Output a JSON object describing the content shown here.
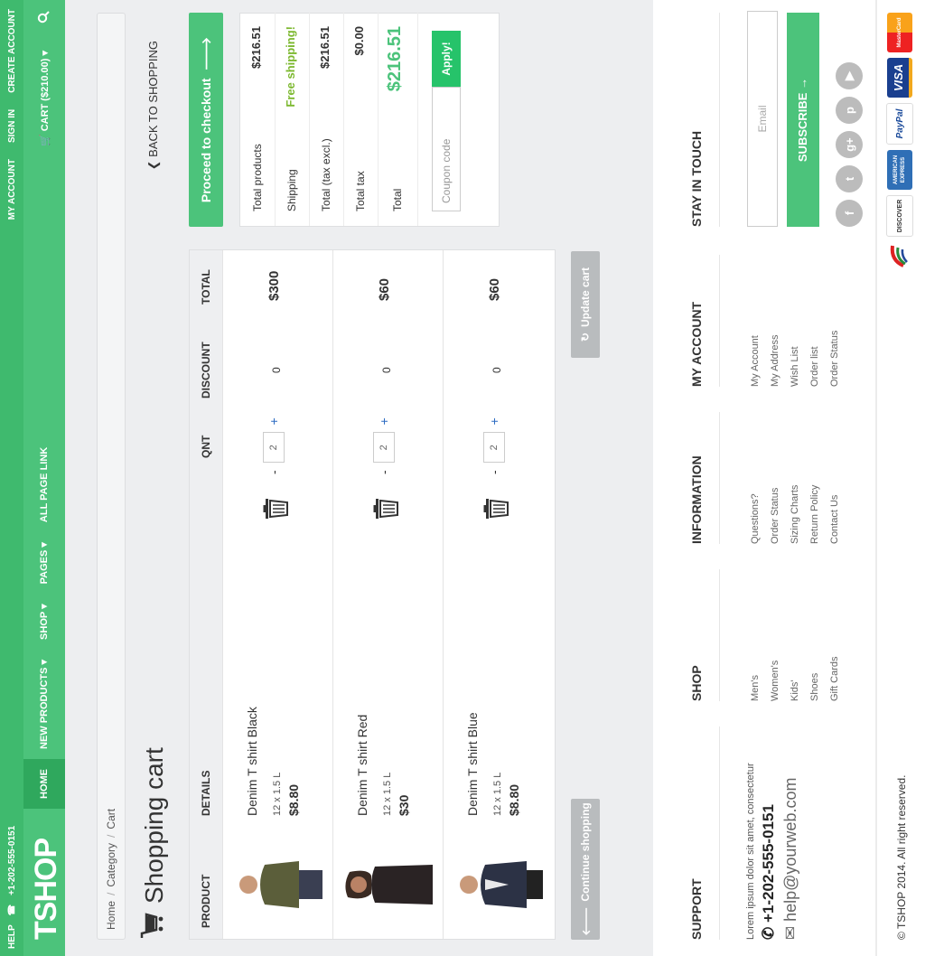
{
  "topbar": {
    "help": "HELP",
    "phone": "+1-202-555-0151",
    "links": [
      "MY ACCOUNT",
      "SIGN IN",
      "CREATE ACCOUNT"
    ]
  },
  "nav": {
    "logo": "TSHOP",
    "links": [
      "HOME",
      "NEW PRODUCTS",
      "SHOP",
      "PAGES",
      "ALL PAGE LINK"
    ],
    "cart": "CART ($210.00)"
  },
  "breadcrumb": [
    "Home",
    "Category",
    "Cart"
  ],
  "page_title": "Shopping cart",
  "back_link": "BACK TO SHOPPING",
  "cart": {
    "headers": [
      "PRODUCT",
      "DETAILS",
      "QNT",
      "DISCOUNT",
      "TOTAL"
    ],
    "rows": [
      {
        "name": "Denim T shirt Black",
        "size": "12 x 1.5 L",
        "price": "$8.80",
        "qty": "2",
        "discount": "0",
        "total": "$300",
        "color": "#5b5e3a"
      },
      {
        "name": "Denim T shirt Red",
        "size": "12 x 1.5 L",
        "price": "$30",
        "qty": "2",
        "discount": "0",
        "total": "$60",
        "color": "#2a2324"
      },
      {
        "name": "Denim T shirt Blue",
        "size": "12 x 1.5 L",
        "price": "$8.80",
        "qty": "2",
        "discount": "0",
        "total": "$60",
        "color": "#2c3245"
      }
    ],
    "minus": "-",
    "plus": "+",
    "continue": "Continue shopping",
    "update": "Update cart"
  },
  "summary": {
    "checkout": "Proceed to checkout",
    "rows": [
      {
        "label": "Total products",
        "value": "$216.51"
      },
      {
        "label": "Shipping",
        "value": "Free shipping!"
      },
      {
        "label": "Total (tax excl.)",
        "value": "$216.51"
      },
      {
        "label": "Total tax",
        "value": "$0.00"
      },
      {
        "label": "Total",
        "value": "$216.51"
      }
    ],
    "coupon_placeholder": "Coupon code",
    "apply": "Apply!"
  },
  "footer": {
    "support": {
      "heading": "SUPPORT",
      "text": "Lorem ipsum dolor sit amet, consectetur",
      "phone": "+1-202-555-0151",
      "email": "help@yourweb.com"
    },
    "shop": {
      "heading": "SHOP",
      "items": [
        "Men's",
        "Women's",
        "Kids'",
        "Shoes",
        "Gift Cards"
      ]
    },
    "information": {
      "heading": "INFORMATION",
      "items": [
        "Questions?",
        "Order Status",
        "Sizing Charts",
        "Return Policy",
        "Contact Us"
      ]
    },
    "account": {
      "heading": "MY ACCOUNT",
      "items": [
        "My Account",
        "My Address",
        "Wish List",
        "Order list",
        "Order Status"
      ]
    },
    "touch": {
      "heading": "STAY IN TOUCH",
      "email_placeholder": "Email",
      "subscribe": "SUBSCRIBE"
    },
    "copyright": "© TSHOP 2014. All right reserved.",
    "payments": [
      "DISCOVER",
      "AMERICAN EXPRESS",
      "PayPal",
      "VISA",
      "MasterCard"
    ]
  },
  "colors": {
    "brand": "#4cc37b",
    "brand_dark": "#3fba6e",
    "accent_green_text": "#7cb82f",
    "grey_button": "#b9bcbe"
  }
}
